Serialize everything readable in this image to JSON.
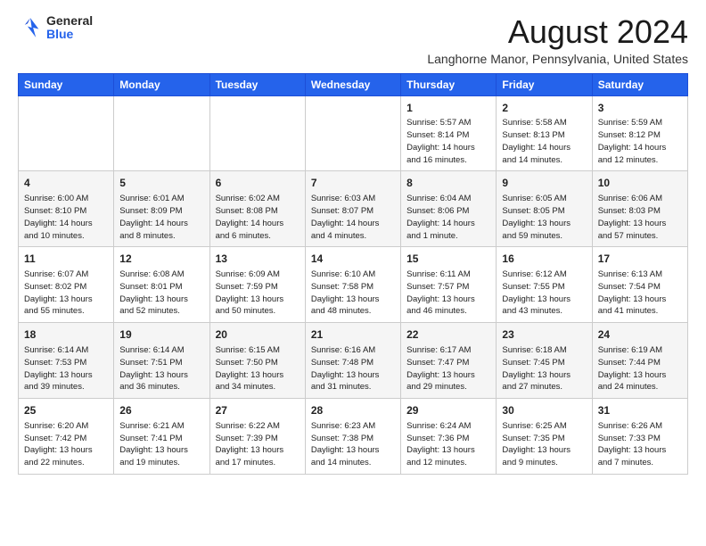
{
  "header": {
    "logo_general": "General",
    "logo_blue": "Blue",
    "month_year": "August 2024",
    "location": "Langhorne Manor, Pennsylvania, United States"
  },
  "calendar": {
    "days_of_week": [
      "Sunday",
      "Monday",
      "Tuesday",
      "Wednesday",
      "Thursday",
      "Friday",
      "Saturday"
    ],
    "weeks": [
      [
        {
          "day": "",
          "content": ""
        },
        {
          "day": "",
          "content": ""
        },
        {
          "day": "",
          "content": ""
        },
        {
          "day": "",
          "content": ""
        },
        {
          "day": "1",
          "content": "Sunrise: 5:57 AM\nSunset: 8:14 PM\nDaylight: 14 hours\nand 16 minutes."
        },
        {
          "day": "2",
          "content": "Sunrise: 5:58 AM\nSunset: 8:13 PM\nDaylight: 14 hours\nand 14 minutes."
        },
        {
          "day": "3",
          "content": "Sunrise: 5:59 AM\nSunset: 8:12 PM\nDaylight: 14 hours\nand 12 minutes."
        }
      ],
      [
        {
          "day": "4",
          "content": "Sunrise: 6:00 AM\nSunset: 8:10 PM\nDaylight: 14 hours\nand 10 minutes."
        },
        {
          "day": "5",
          "content": "Sunrise: 6:01 AM\nSunset: 8:09 PM\nDaylight: 14 hours\nand 8 minutes."
        },
        {
          "day": "6",
          "content": "Sunrise: 6:02 AM\nSunset: 8:08 PM\nDaylight: 14 hours\nand 6 minutes."
        },
        {
          "day": "7",
          "content": "Sunrise: 6:03 AM\nSunset: 8:07 PM\nDaylight: 14 hours\nand 4 minutes."
        },
        {
          "day": "8",
          "content": "Sunrise: 6:04 AM\nSunset: 8:06 PM\nDaylight: 14 hours\nand 1 minute."
        },
        {
          "day": "9",
          "content": "Sunrise: 6:05 AM\nSunset: 8:05 PM\nDaylight: 13 hours\nand 59 minutes."
        },
        {
          "day": "10",
          "content": "Sunrise: 6:06 AM\nSunset: 8:03 PM\nDaylight: 13 hours\nand 57 minutes."
        }
      ],
      [
        {
          "day": "11",
          "content": "Sunrise: 6:07 AM\nSunset: 8:02 PM\nDaylight: 13 hours\nand 55 minutes."
        },
        {
          "day": "12",
          "content": "Sunrise: 6:08 AM\nSunset: 8:01 PM\nDaylight: 13 hours\nand 52 minutes."
        },
        {
          "day": "13",
          "content": "Sunrise: 6:09 AM\nSunset: 7:59 PM\nDaylight: 13 hours\nand 50 minutes."
        },
        {
          "day": "14",
          "content": "Sunrise: 6:10 AM\nSunset: 7:58 PM\nDaylight: 13 hours\nand 48 minutes."
        },
        {
          "day": "15",
          "content": "Sunrise: 6:11 AM\nSunset: 7:57 PM\nDaylight: 13 hours\nand 46 minutes."
        },
        {
          "day": "16",
          "content": "Sunrise: 6:12 AM\nSunset: 7:55 PM\nDaylight: 13 hours\nand 43 minutes."
        },
        {
          "day": "17",
          "content": "Sunrise: 6:13 AM\nSunset: 7:54 PM\nDaylight: 13 hours\nand 41 minutes."
        }
      ],
      [
        {
          "day": "18",
          "content": "Sunrise: 6:14 AM\nSunset: 7:53 PM\nDaylight: 13 hours\nand 39 minutes."
        },
        {
          "day": "19",
          "content": "Sunrise: 6:14 AM\nSunset: 7:51 PM\nDaylight: 13 hours\nand 36 minutes."
        },
        {
          "day": "20",
          "content": "Sunrise: 6:15 AM\nSunset: 7:50 PM\nDaylight: 13 hours\nand 34 minutes."
        },
        {
          "day": "21",
          "content": "Sunrise: 6:16 AM\nSunset: 7:48 PM\nDaylight: 13 hours\nand 31 minutes."
        },
        {
          "day": "22",
          "content": "Sunrise: 6:17 AM\nSunset: 7:47 PM\nDaylight: 13 hours\nand 29 minutes."
        },
        {
          "day": "23",
          "content": "Sunrise: 6:18 AM\nSunset: 7:45 PM\nDaylight: 13 hours\nand 27 minutes."
        },
        {
          "day": "24",
          "content": "Sunrise: 6:19 AM\nSunset: 7:44 PM\nDaylight: 13 hours\nand 24 minutes."
        }
      ],
      [
        {
          "day": "25",
          "content": "Sunrise: 6:20 AM\nSunset: 7:42 PM\nDaylight: 13 hours\nand 22 minutes."
        },
        {
          "day": "26",
          "content": "Sunrise: 6:21 AM\nSunset: 7:41 PM\nDaylight: 13 hours\nand 19 minutes."
        },
        {
          "day": "27",
          "content": "Sunrise: 6:22 AM\nSunset: 7:39 PM\nDaylight: 13 hours\nand 17 minutes."
        },
        {
          "day": "28",
          "content": "Sunrise: 6:23 AM\nSunset: 7:38 PM\nDaylight: 13 hours\nand 14 minutes."
        },
        {
          "day": "29",
          "content": "Sunrise: 6:24 AM\nSunset: 7:36 PM\nDaylight: 13 hours\nand 12 minutes."
        },
        {
          "day": "30",
          "content": "Sunrise: 6:25 AM\nSunset: 7:35 PM\nDaylight: 13 hours\nand 9 minutes."
        },
        {
          "day": "31",
          "content": "Sunrise: 6:26 AM\nSunset: 7:33 PM\nDaylight: 13 hours\nand 7 minutes."
        }
      ]
    ]
  }
}
